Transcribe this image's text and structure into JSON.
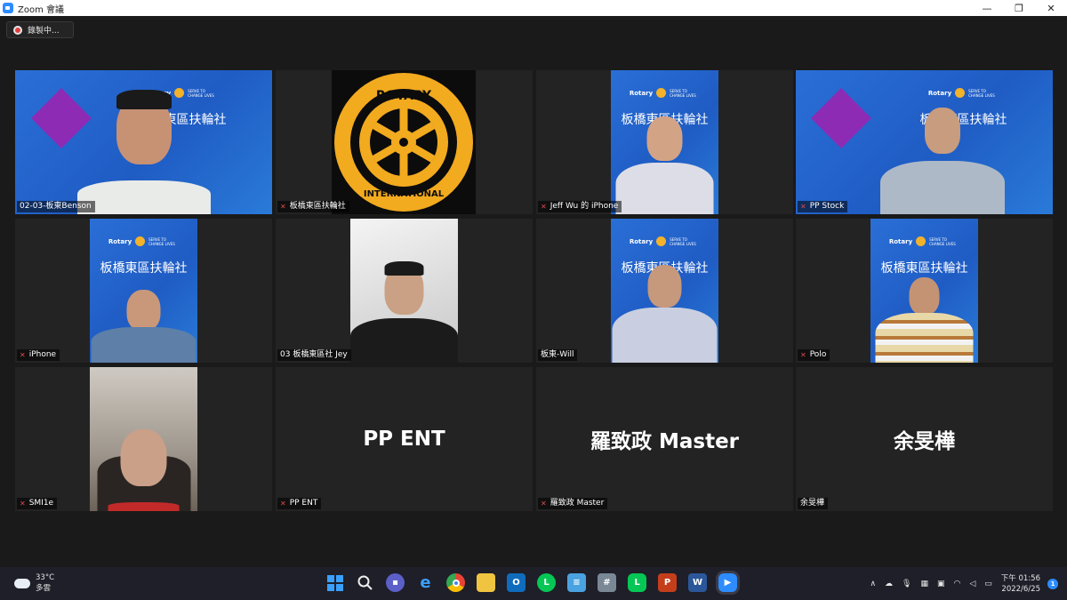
{
  "window": {
    "title": "Zoom 會議",
    "minimize": "—",
    "restore": "❐",
    "close": "✕"
  },
  "recording": {
    "label": "錄製中..."
  },
  "brand": {
    "rotary": "Rotary",
    "slogan": "SERVE TO CHANGE LIVES",
    "club": "板橋東區扶輪社"
  },
  "participants": [
    {
      "name": "02-03-板東Benson",
      "muted": false,
      "active": true
    },
    {
      "name": "板橋東區扶輪社",
      "muted": true
    },
    {
      "name": "Jeff Wu 的 iPhone",
      "muted": true
    },
    {
      "name": "PP Stock",
      "muted": true
    },
    {
      "name": "iPhone",
      "muted": true
    },
    {
      "name": "03 板橋東區社 Jey",
      "muted": false
    },
    {
      "name": "板東-Will",
      "muted": false
    },
    {
      "name": "Polo",
      "muted": true
    },
    {
      "name": "SMI1e",
      "muted": true
    },
    {
      "name": "PP ENT",
      "muted": true,
      "placeholder": "PP ENT"
    },
    {
      "name": "羅致政 Master",
      "muted": true,
      "placeholder": "羅致政 Master"
    },
    {
      "name": "余旻樺",
      "muted": false,
      "placeholder": "余旻樺"
    }
  ],
  "rotary_logo": {
    "top": "ROTARY",
    "bottom": "INTERNATIONAL"
  },
  "taskbar": {
    "temperature": "33°C",
    "weather": "多雲",
    "time": "下午 01:56",
    "date": "2022/6/25",
    "notifications": "1"
  },
  "colors": {
    "accent": "#2d8cff",
    "active_speaker": "#b5e35b",
    "muted": "#e04848"
  }
}
